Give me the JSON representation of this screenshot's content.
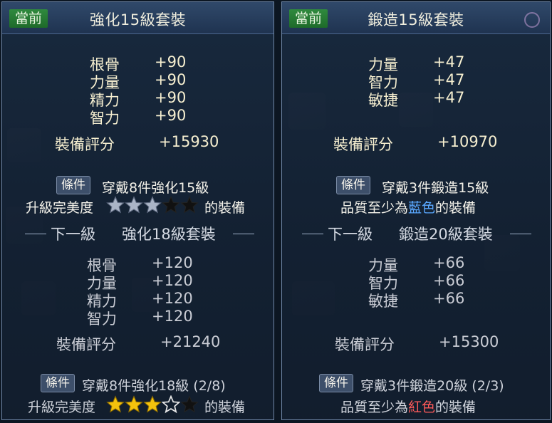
{
  "colors": {
    "star_gold": "#f4c20d",
    "star_silver": "#aab4c6",
    "star_dark": "#111111",
    "blue_text": "#5aa8ff",
    "red_text": "#ff5a5a",
    "badge_green": "#2f8a3e"
  },
  "left": {
    "badge": "當前",
    "title": "強化15級套裝",
    "current_stats": [
      {
        "label": "根骨",
        "value": "+90"
      },
      {
        "label": "力量",
        "value": "+90"
      },
      {
        "label": "精力",
        "value": "+90"
      },
      {
        "label": "智力",
        "value": "+90"
      }
    ],
    "score_label": "裝備評分",
    "score_value": "+15930",
    "condition_badge": "條件",
    "condition_text": "穿戴8件強化15級",
    "perfection_prefix": "升級完美度",
    "perfection_suffix": "的裝備",
    "perfection_stars": 3,
    "perfection_max_stars": 5,
    "next_label": "下一級",
    "next_title": "強化18級套裝",
    "next_stats": [
      {
        "label": "根骨",
        "value": "+120"
      },
      {
        "label": "力量",
        "value": "+120"
      },
      {
        "label": "精力",
        "value": "+120"
      },
      {
        "label": "智力",
        "value": "+120"
      }
    ],
    "next_score_label": "裝備評分",
    "next_score_value": "+21240",
    "next_condition_badge": "條件",
    "next_condition_text": "穿戴8件強化18級 (2/8)",
    "next_perfection_prefix": "升級完美度",
    "next_perfection_suffix": "的裝備",
    "next_perfection_stars": 3
  },
  "right": {
    "badge": "當前",
    "title": "鍛造15級套裝",
    "current_stats": [
      {
        "label": "力量",
        "value": "+47"
      },
      {
        "label": "智力",
        "value": "+47"
      },
      {
        "label": "敏捷",
        "value": "+47"
      }
    ],
    "score_label": "裝備評分",
    "score_value": "+10970",
    "condition_badge": "條件",
    "condition_text": "穿戴3件鍛造15級",
    "quality_prefix": "品質至少為",
    "quality_color_word": "藍色",
    "quality_suffix": "的裝備",
    "next_label": "下一級",
    "next_title": "鍛造20級套裝",
    "next_stats": [
      {
        "label": "力量",
        "value": "+66"
      },
      {
        "label": "智力",
        "value": "+66"
      },
      {
        "label": "敏捷",
        "value": "+66"
      }
    ],
    "next_score_label": "裝備評分",
    "next_score_value": "+15300",
    "next_condition_badge": "條件",
    "next_condition_text": "穿戴3件鍛造20級 (2/3)",
    "next_quality_prefix": "品質至少為",
    "next_quality_color_word": "紅色",
    "next_quality_suffix": "的裝備"
  }
}
